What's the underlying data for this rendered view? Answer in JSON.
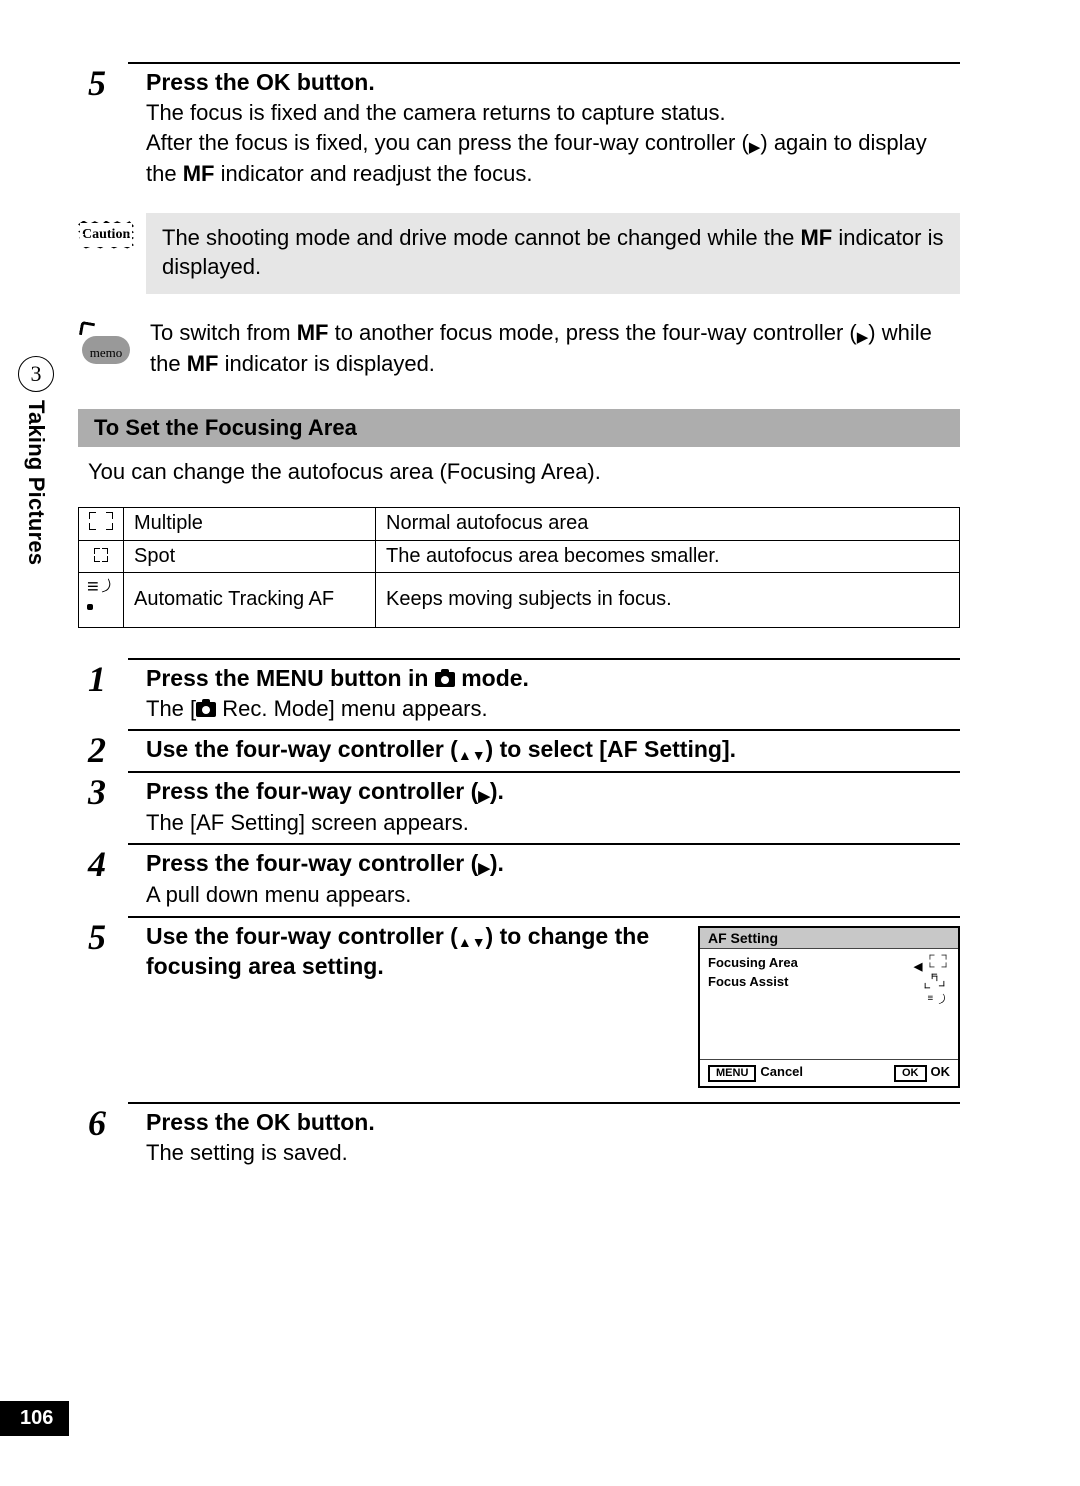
{
  "sidebar": {
    "chapter": "3",
    "label": "Taking Pictures"
  },
  "page_number": "106",
  "step5_top": {
    "num": "5",
    "title_before": "Press the ",
    "title_ok": "OK",
    "title_after": " button.",
    "body_l1": "The focus is fixed and the camera returns to capture status.",
    "body_l2a": "After the focus is fixed, you can press the four-way controller (",
    "body_l2b": ") again to display the ",
    "body_mf": "MF",
    "body_l2c": " indicator and readjust the focus."
  },
  "caution": {
    "label": "Caution",
    "text_a": "The shooting mode and drive mode cannot be changed while the ",
    "text_mf": "MF",
    "text_b": " indicator is displayed."
  },
  "memo": {
    "label": "memo",
    "a": "To switch from ",
    "mf1": "MF",
    "b": " to another focus mode, press the four-way controller (",
    "c": ") while the ",
    "mf2": "MF",
    "d": " indicator is displayed."
  },
  "section": {
    "bar": "To Set the Focusing Area",
    "intro": "You can change the autofocus area (Focusing Area)."
  },
  "table": [
    {
      "name": "Multiple",
      "desc": "Normal autofocus area"
    },
    {
      "name": "Spot",
      "desc": "The autofocus area becomes smaller."
    },
    {
      "name": "Automatic Tracking AF",
      "desc": "Keeps moving subjects in focus."
    }
  ],
  "steps": {
    "s1": {
      "num": "1",
      "a": "Press the ",
      "menu": "MENU",
      "b": " button in ",
      "c": " mode.",
      "body_a": "The [",
      "body_b": " Rec. Mode] menu appears."
    },
    "s2": {
      "num": "2",
      "a": "Use the four-way controller (",
      "b": ") to select [AF Setting]."
    },
    "s3": {
      "num": "3",
      "a": "Press the four-way controller (",
      "b": ").",
      "body": "The [AF Setting] screen appears."
    },
    "s4": {
      "num": "4",
      "a": "Press the four-way controller (",
      "b": ").",
      "body": "A pull down menu appears."
    },
    "s5": {
      "num": "5",
      "a": "Use the four-way controller (",
      "b": ") to change the focusing area setting."
    },
    "s6": {
      "num": "6",
      "a": "Press the ",
      "ok": "OK",
      "b": " button.",
      "body": "The setting is saved."
    }
  },
  "lcd": {
    "title": "AF Setting",
    "row1": "Focusing Area",
    "row2": "Focus Assist",
    "menu_box": "MENU",
    "cancel": "Cancel",
    "ok_box": "OK",
    "ok_txt": "OK"
  }
}
